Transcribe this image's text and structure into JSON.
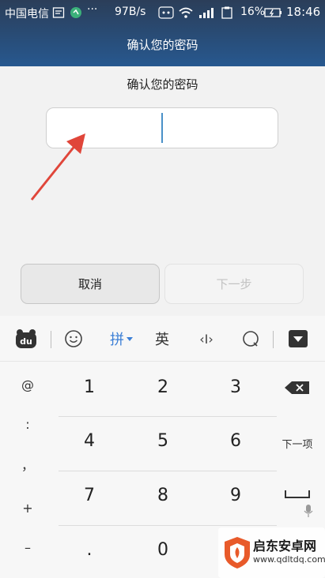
{
  "status_bar": {
    "carrier": "中国电信",
    "dots": "···",
    "speed": "97B/s",
    "battery": "16%",
    "time": "18:46"
  },
  "header": {
    "title": "确认您的密码"
  },
  "form": {
    "prompt": "确认您的密码",
    "password_value": "",
    "cancel_label": "取消",
    "next_label": "下一步"
  },
  "ime": {
    "toolbar": {
      "logo": "du",
      "pinyin_label": "拼",
      "english_label": "英",
      "cursor_label": "‹I›"
    },
    "symbols": [
      "@",
      ":",
      "，",
      "+",
      "–"
    ],
    "digits": [
      [
        "1",
        "2",
        "3"
      ],
      [
        "4",
        "5",
        "6"
      ],
      [
        "7",
        "8",
        "9"
      ],
      [
        ".",
        "0",
        ""
      ]
    ],
    "next_item_label": "下一项"
  },
  "watermark": {
    "name": "启东安卓网",
    "url": "www.qdltdq.com"
  },
  "colors": {
    "accent": "#3b7fd6",
    "header_top": "#2b3e59",
    "header_bottom": "#27588f",
    "arrow": "#e0463a"
  }
}
